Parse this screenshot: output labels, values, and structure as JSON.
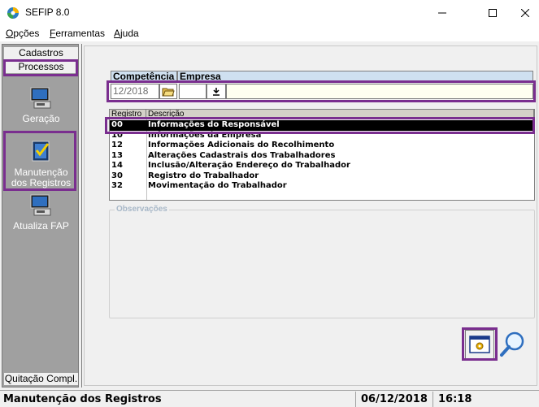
{
  "window": {
    "title": "SEFIP 8.0",
    "icons": {
      "app": "sefip-app-icon",
      "minimize": "minimize-icon",
      "maximize": "maximize-icon",
      "close": "close-icon"
    }
  },
  "menu": {
    "items": [
      {
        "first": "O",
        "rest": "pções"
      },
      {
        "first": "F",
        "rest": "erramentas"
      },
      {
        "first": "A",
        "rest": "juda"
      }
    ]
  },
  "sidebar": {
    "tab_cadastros": "Cadastros",
    "tab_processos": "Processos",
    "geracao": "Geração",
    "manutencao_line1": "Manutenção",
    "manutencao_line2": "dos Registros",
    "atualiza_fap": "Atualiza FAP",
    "quitacao": "Quitação Compl."
  },
  "form": {
    "competencia_label": "Competência",
    "empresa_label": "Empresa",
    "competencia_value": "12/2018",
    "empresa_value": "",
    "empresa_name": ""
  },
  "grid": {
    "headers": [
      "Registro",
      "Descrição"
    ],
    "rows": [
      {
        "code": "00",
        "desc": "Informações do Responsável",
        "selected": true
      },
      {
        "code": "10",
        "desc": "Informações da Empresa"
      },
      {
        "code": "12",
        "desc": "Informações Adicionais do Recolhimento"
      },
      {
        "code": "13",
        "desc": "Alterações Cadastrais dos Trabalhadores"
      },
      {
        "code": "14",
        "desc": "Inclusão/Alteração Endereço do Trabalhador"
      },
      {
        "code": "30",
        "desc": "Registro do Trabalhador"
      },
      {
        "code": "32",
        "desc": "Movimentação do Trabalhador"
      }
    ]
  },
  "observacoes_label": "Observações",
  "status": {
    "module": "Manutenção dos Registros",
    "date": "06/12/2018",
    "time": "16:18"
  },
  "colors": {
    "highlight": "#7a2e8f",
    "sidebar_bg": "#a0a0a0",
    "header_bg": "#cfe0f0",
    "selected_row": "#000000"
  }
}
